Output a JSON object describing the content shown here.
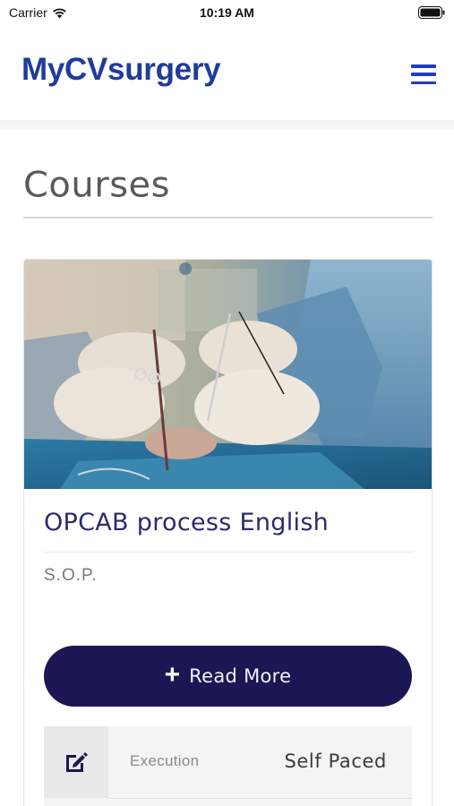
{
  "status_bar": {
    "carrier": "Carrier",
    "time": "10:19 AM"
  },
  "header": {
    "logo": "MyCVsurgery",
    "menu_icon": "hamburger-menu-icon",
    "accent_color": "#1f3c9a"
  },
  "page": {
    "title": "Courses"
  },
  "course": {
    "image": "surgery-photo",
    "title": "OPCAB process English",
    "subtitle": "S.O.P.",
    "read_more_label": "Read More",
    "read_more_icon": "plus-icon",
    "button_color": "#1b1754",
    "info": {
      "icon": "edit-icon",
      "label": "Execution",
      "value": "Self Paced"
    }
  }
}
